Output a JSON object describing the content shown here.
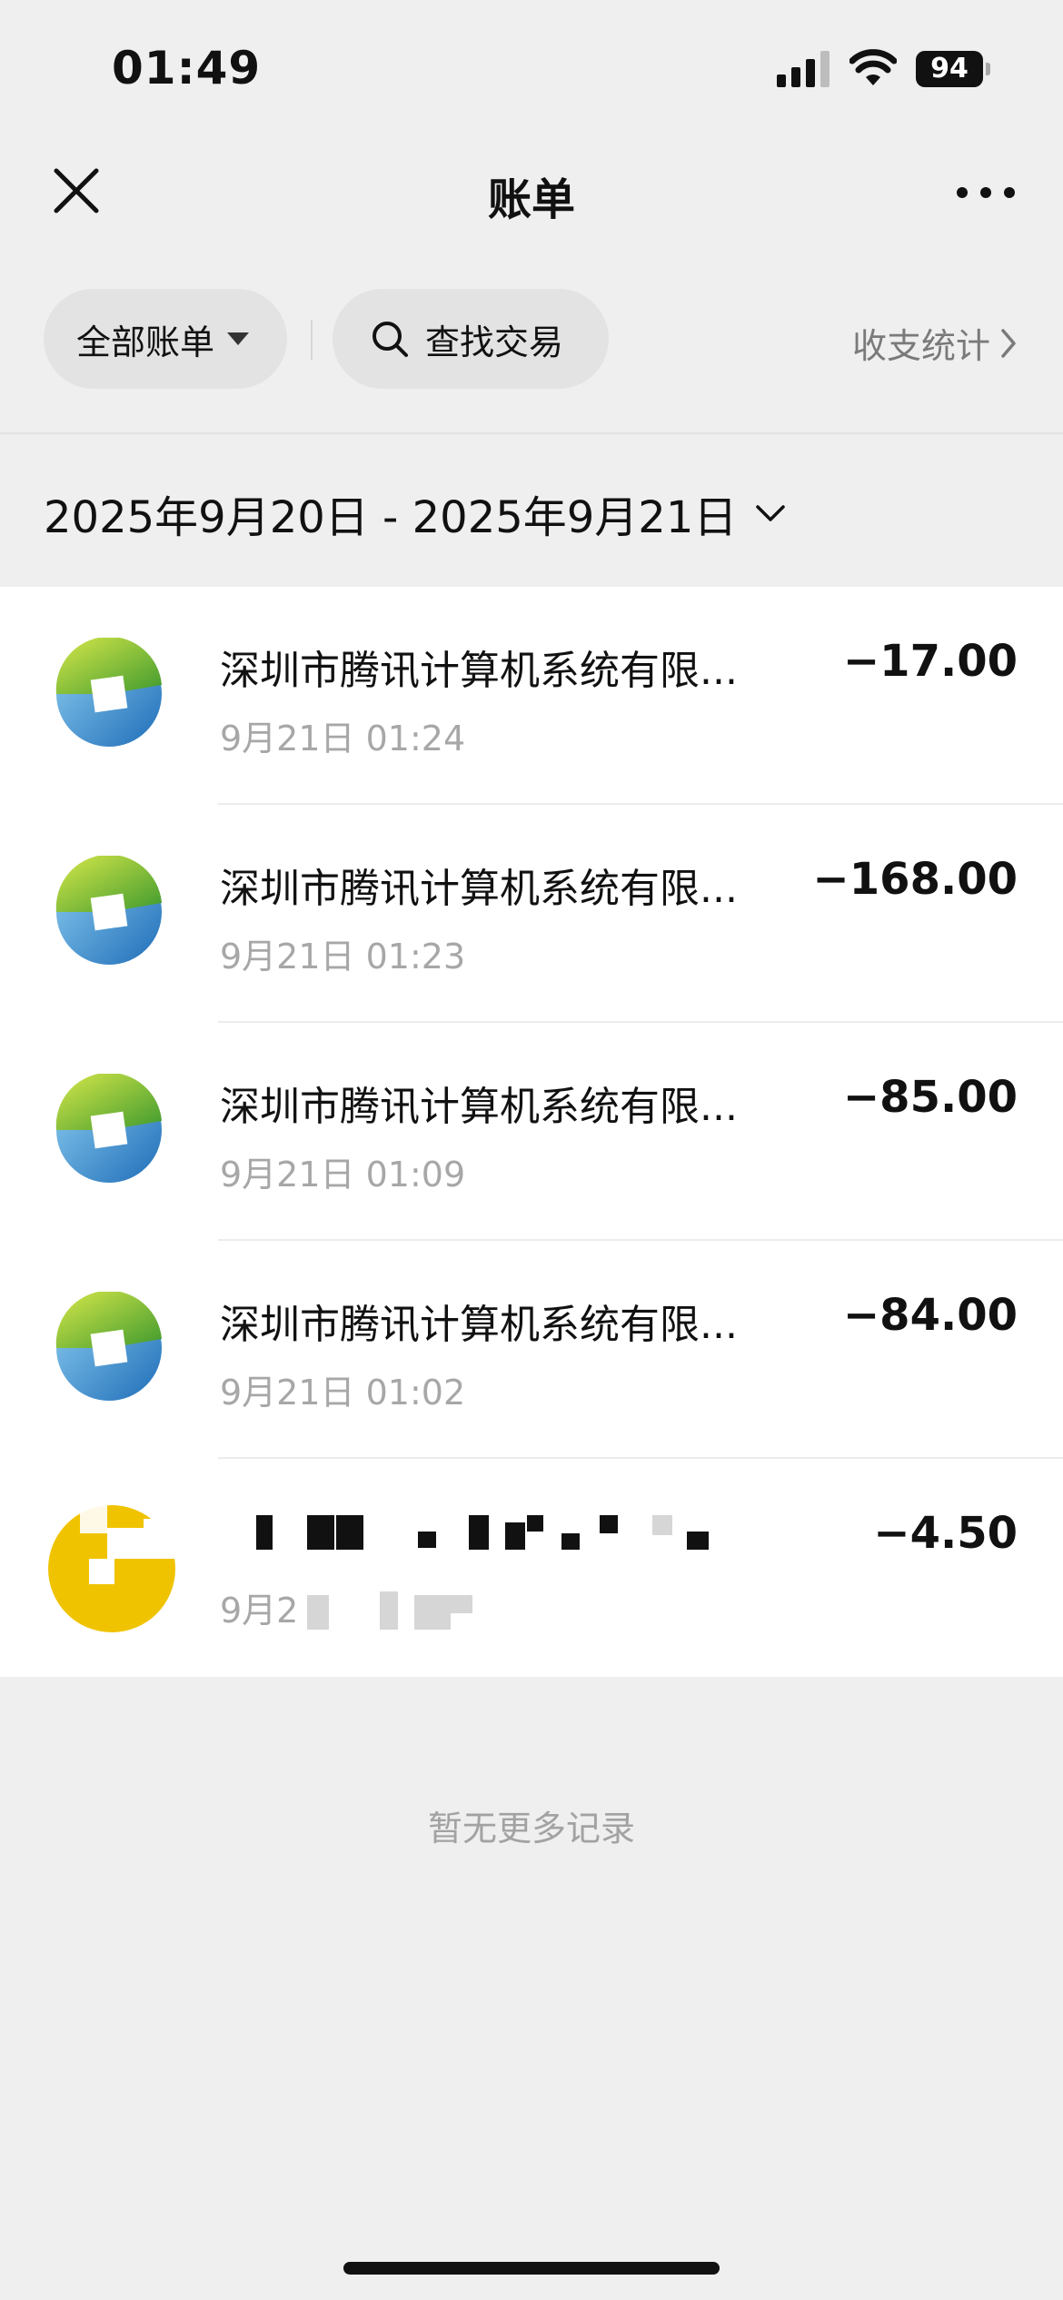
{
  "status_bar": {
    "time": "01:49",
    "battery": "94"
  },
  "nav": {
    "title": "账单"
  },
  "filters": {
    "all_bills": "全部账单",
    "search": "查找交易",
    "stats": "收支统计"
  },
  "date_range": "2025年9月20日 - 2025年9月21日",
  "transactions": [
    {
      "merchant": "深圳市腾讯计算机系统有限...",
      "time": "9月21日 01:24",
      "amount": "−17.00"
    },
    {
      "merchant": "深圳市腾讯计算机系统有限...",
      "time": "9月21日 01:23",
      "amount": "−168.00"
    },
    {
      "merchant": "深圳市腾讯计算机系统有限...",
      "time": "9月21日 01:09",
      "amount": "−85.00"
    },
    {
      "merchant": "深圳市腾讯计算机系统有限...",
      "time": "9月21日 01:02",
      "amount": "−84.00"
    },
    {
      "merchant": "",
      "time": "9月2",
      "amount": "−4.50"
    }
  ],
  "footer": {
    "no_more": "暂无更多记录"
  },
  "colors": {
    "background": "#efefef",
    "accent_yellow": "#f0c300"
  }
}
